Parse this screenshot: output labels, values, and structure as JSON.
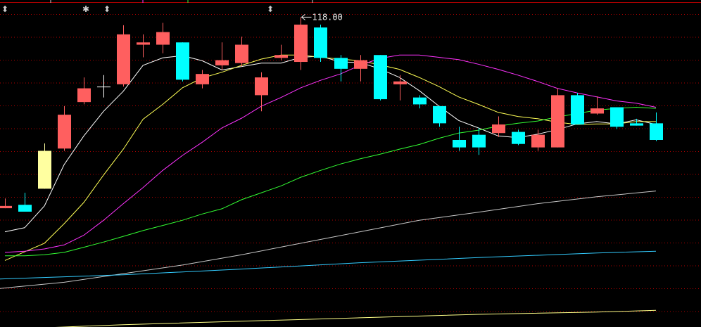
{
  "markers": [
    {
      "symbol": "⬍",
      "name": "event-marker-1"
    },
    {
      "symbol": "✱",
      "name": "event-marker-2"
    },
    {
      "symbol": "⬍",
      "name": "event-marker-3"
    },
    {
      "symbol": "⬍",
      "name": "event-marker-4"
    }
  ],
  "chart_data": {
    "type": "candlestick",
    "ylim": [
      64.0,
      120.5
    ],
    "grid": true,
    "colors": {
      "up": "#ff5f5f",
      "down": "#00ffff",
      "flat": "#ffffff",
      "up_special": "#ffffa0",
      "ma5": "#ffffff",
      "ma10": "#ffff55",
      "ma20": "#ff33ff",
      "ma30": "#33ff33",
      "ma60": "#c8c8c8",
      "ma120": "#33ccff",
      "ma250": "#ffff88",
      "grid": "#b00000"
    },
    "annotation": {
      "text": "118.00",
      "candle_index": 15,
      "value": 118.0
    },
    "candles": [
      {
        "o": 84.7,
        "c": 85.1,
        "h": 86.4,
        "l": 84.7
      },
      {
        "o": 85.3,
        "c": 84.1,
        "h": 87.4,
        "l": 84.1
      },
      {
        "o": 88.1,
        "c": 94.7,
        "h": 96.0,
        "l": 88.1,
        "special": true
      },
      {
        "o": 95.1,
        "c": 101.0,
        "h": 102.5,
        "l": 94.7
      },
      {
        "o": 103.2,
        "c": 105.6,
        "h": 107.5,
        "l": 102.8
      },
      {
        "o": 105.9,
        "c": 105.9,
        "h": 107.9,
        "l": 104.0
      },
      {
        "o": 106.3,
        "c": 115.0,
        "h": 116.6,
        "l": 105.9
      },
      {
        "o": 113.2,
        "c": 113.6,
        "h": 115.0,
        "l": 111.0
      },
      {
        "o": 113.2,
        "c": 115.4,
        "h": 117.0,
        "l": 111.7
      },
      {
        "o": 113.6,
        "c": 107.1,
        "h": 113.6,
        "l": 106.8
      },
      {
        "o": 106.3,
        "c": 108.1,
        "h": 108.8,
        "l": 105.6
      },
      {
        "o": 109.6,
        "c": 110.5,
        "h": 113.6,
        "l": 108.8
      },
      {
        "o": 110.0,
        "c": 113.2,
        "h": 114.6,
        "l": 109.4
      },
      {
        "o": 104.4,
        "c": 107.5,
        "h": 108.4,
        "l": 101.6
      },
      {
        "o": 110.9,
        "c": 111.4,
        "h": 113.2,
        "l": 110.5
      },
      {
        "o": 110.2,
        "c": 116.7,
        "h": 118.0,
        "l": 108.8
      },
      {
        "o": 116.2,
        "c": 110.9,
        "h": 116.7,
        "l": 110.2
      },
      {
        "o": 110.9,
        "c": 109.0,
        "h": 111.4,
        "l": 106.8
      },
      {
        "o": 109.0,
        "c": 110.5,
        "h": 111.4,
        "l": 106.8
      },
      {
        "o": 111.4,
        "c": 103.7,
        "h": 111.4,
        "l": 103.5
      },
      {
        "o": 106.3,
        "c": 106.8,
        "h": 107.9,
        "l": 103.5
      },
      {
        "o": 104.0,
        "c": 102.8,
        "h": 104.4,
        "l": 102.1
      },
      {
        "o": 102.5,
        "c": 99.5,
        "h": 102.5,
        "l": 98.9
      },
      {
        "o": 96.6,
        "c": 95.3,
        "h": 98.9,
        "l": 94.7
      },
      {
        "o": 97.5,
        "c": 95.3,
        "h": 98.7,
        "l": 94.0
      },
      {
        "o": 97.8,
        "c": 99.3,
        "h": 100.7,
        "l": 97.1
      },
      {
        "o": 98.0,
        "c": 95.9,
        "h": 98.4,
        "l": 95.7
      },
      {
        "o": 95.3,
        "c": 97.5,
        "h": 98.4,
        "l": 94.7
      },
      {
        "o": 95.3,
        "c": 104.4,
        "h": 105.6,
        "l": 95.3
      },
      {
        "o": 104.4,
        "c": 99.3,
        "h": 104.8,
        "l": 99.3
      },
      {
        "o": 101.2,
        "c": 102.1,
        "h": 104.2,
        "l": 101.0
      },
      {
        "o": 102.3,
        "c": 98.9,
        "h": 102.3,
        "l": 98.5
      },
      {
        "o": 99.5,
        "c": 99.1,
        "h": 100.3,
        "l": 99.1
      },
      {
        "o": 99.5,
        "c": 96.6,
        "h": 101.4,
        "l": 96.4
      }
    ],
    "ma_lines": [
      {
        "key": "ma5",
        "values": [
          [
            0,
            80.6
          ],
          [
            1,
            81.3
          ],
          [
            2,
            85.1
          ],
          [
            3,
            92.3
          ],
          [
            4,
            97.3
          ],
          [
            5,
            101.6
          ],
          [
            6,
            105.1
          ],
          [
            7,
            109.6
          ],
          [
            8,
            110.9
          ],
          [
            9,
            111.3
          ],
          [
            10,
            110.4
          ],
          [
            11,
            108.8
          ],
          [
            12,
            109.4
          ],
          [
            13,
            110.0
          ],
          [
            14,
            110.0
          ],
          [
            15,
            111.0
          ],
          [
            16,
            111.2
          ],
          [
            17,
            110.2
          ],
          [
            18,
            110.1
          ],
          [
            19,
            109.0
          ],
          [
            20,
            107.5
          ],
          [
            21,
            105.2
          ],
          [
            22,
            102.5
          ],
          [
            23,
            100.0
          ],
          [
            24,
            98.7
          ],
          [
            25,
            97.3
          ],
          [
            26,
            97.0
          ],
          [
            27,
            97.6
          ],
          [
            28,
            98.4
          ],
          [
            29,
            99.4
          ],
          [
            30,
            99.8
          ],
          [
            31,
            99.4
          ],
          [
            32,
            100.1
          ],
          [
            33,
            99.3
          ]
        ]
      },
      {
        "key": "ma10",
        "values": [
          [
            0,
            75.6
          ],
          [
            1,
            77.1
          ],
          [
            2,
            78.6
          ],
          [
            3,
            82.0
          ],
          [
            4,
            85.7
          ],
          [
            5,
            90.5
          ],
          [
            6,
            95.0
          ],
          [
            7,
            100.2
          ],
          [
            8,
            102.8
          ],
          [
            9,
            105.7
          ],
          [
            10,
            107.4
          ],
          [
            11,
            108.4
          ],
          [
            12,
            109.6
          ],
          [
            13,
            110.7
          ],
          [
            14,
            111.4
          ],
          [
            15,
            111.4
          ],
          [
            16,
            111.0
          ],
          [
            17,
            110.7
          ],
          [
            18,
            110.4
          ],
          [
            19,
            109.7
          ],
          [
            20,
            108.9
          ],
          [
            21,
            107.5
          ],
          [
            22,
            105.9
          ],
          [
            23,
            104.1
          ],
          [
            24,
            102.8
          ],
          [
            25,
            101.4
          ],
          [
            26,
            100.7
          ],
          [
            27,
            100.3
          ],
          [
            28,
            99.7
          ],
          [
            29,
            99.3
          ],
          [
            30,
            99.4
          ],
          [
            31,
            99.4
          ],
          [
            32,
            99.8
          ],
          [
            33,
            99.8
          ]
        ]
      },
      {
        "key": "ma20",
        "values": [
          [
            0,
            77.0
          ],
          [
            1,
            77.2
          ],
          [
            2,
            77.6
          ],
          [
            3,
            78.3
          ],
          [
            4,
            80.0
          ],
          [
            5,
            82.6
          ],
          [
            6,
            85.5
          ],
          [
            7,
            88.3
          ],
          [
            8,
            91.3
          ],
          [
            9,
            93.9
          ],
          [
            10,
            96.2
          ],
          [
            11,
            98.7
          ],
          [
            12,
            100.4
          ],
          [
            13,
            102.5
          ],
          [
            14,
            104.0
          ],
          [
            15,
            105.7
          ],
          [
            16,
            107.0
          ],
          [
            17,
            108.1
          ],
          [
            18,
            109.6
          ],
          [
            19,
            110.8
          ],
          [
            20,
            111.4
          ],
          [
            21,
            111.4
          ],
          [
            22,
            111.0
          ],
          [
            23,
            110.6
          ],
          [
            24,
            109.8
          ],
          [
            25,
            108.9
          ],
          [
            26,
            107.9
          ],
          [
            27,
            106.8
          ],
          [
            28,
            105.6
          ],
          [
            29,
            104.8
          ],
          [
            30,
            104.1
          ],
          [
            31,
            103.4
          ],
          [
            32,
            103.0
          ],
          [
            33,
            102.3
          ]
        ]
      },
      {
        "key": "ma30",
        "values": [
          [
            0,
            76.4
          ],
          [
            1,
            76.4
          ],
          [
            2,
            76.6
          ],
          [
            3,
            77.0
          ],
          [
            4,
            77.9
          ],
          [
            5,
            78.8
          ],
          [
            6,
            79.8
          ],
          [
            7,
            80.8
          ],
          [
            8,
            81.7
          ],
          [
            9,
            82.6
          ],
          [
            10,
            83.7
          ],
          [
            11,
            84.6
          ],
          [
            12,
            86.2
          ],
          [
            13,
            87.4
          ],
          [
            14,
            88.6
          ],
          [
            15,
            90.1
          ],
          [
            16,
            91.3
          ],
          [
            17,
            92.4
          ],
          [
            18,
            93.3
          ],
          [
            19,
            94.1
          ],
          [
            20,
            95.0
          ],
          [
            21,
            95.8
          ],
          [
            22,
            96.9
          ],
          [
            23,
            97.8
          ],
          [
            24,
            98.3
          ],
          [
            25,
            99.0
          ],
          [
            26,
            99.5
          ],
          [
            27,
            99.9
          ],
          [
            28,
            100.6
          ],
          [
            29,
            101.2
          ],
          [
            30,
            101.8
          ],
          [
            31,
            102.1
          ],
          [
            32,
            102.3
          ],
          [
            33,
            102.1
          ]
        ]
      },
      {
        "key": "ma60",
        "values": [
          [
            0,
            70.8
          ],
          [
            3,
            71.8
          ],
          [
            6,
            73.3
          ],
          [
            9,
            74.8
          ],
          [
            12,
            76.6
          ],
          [
            15,
            78.6
          ],
          [
            18,
            80.6
          ],
          [
            21,
            82.6
          ],
          [
            24,
            84.0
          ],
          [
            27,
            85.5
          ],
          [
            30,
            86.7
          ],
          [
            33,
            87.7
          ]
        ]
      },
      {
        "key": "ma120",
        "values": [
          [
            0,
            72.4
          ],
          [
            6,
            73.1
          ],
          [
            12,
            74.1
          ],
          [
            18,
            75.2
          ],
          [
            24,
            76.1
          ],
          [
            30,
            76.9
          ],
          [
            33,
            77.2
          ]
        ]
      },
      {
        "key": "ma250",
        "values": [
          [
            0,
            63.6
          ],
          [
            6,
            64.4
          ],
          [
            12,
            65.0
          ],
          [
            18,
            65.6
          ],
          [
            24,
            66.2
          ],
          [
            30,
            66.6
          ],
          [
            33,
            66.9
          ]
        ]
      }
    ]
  }
}
